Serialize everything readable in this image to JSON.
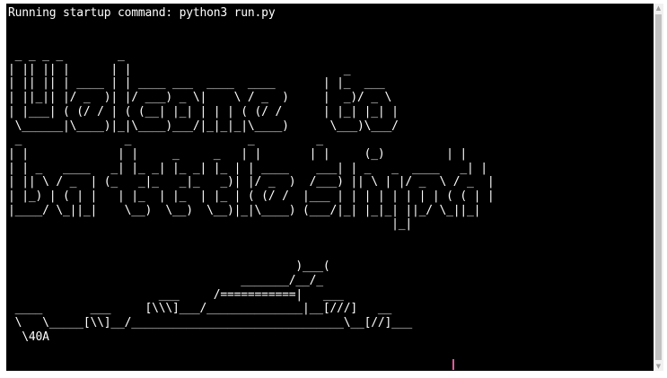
{
  "colors": {
    "background": "#000000",
    "text": "#ffffff",
    "cursor": "#e05a9a",
    "scrollbar_track": "#f1f1f1",
    "scrollbar_thumb": "#c1c1c1"
  },
  "terminal": {
    "lines": [
      "Running startup command: python3 run.py",
      "",
      "",
      " _ _ _ _        _",
      "| || || |      | |                               _",
      "| || || | ____ | | ____ ___  ____  ____       | |_  ___",
      "| ||_|| |/ _  )| |/ ___) _ \\|    \\ / _  )     |  _)/ _ \\",
      "| |___| ( (/ / | ( (__| |_| | | | ( (/ /      | |_| |_| |",
      " \\______|\\____)|_|\\____)___/|_|_|_|\\____)      \\___)\\___/",
      " _               _                 _         _",
      "| |             | |     _     _   | |       | |     (_)         | |",
      "| | _   ____   _| |_ _| |_ _| |_ | | ____    ___| | _   _  ____   _| |",
      "| || \\ / _  | (_   _|_   _|_   _)| |/ _  )  /___) || \\ | |/ _  \\ / _  |",
      "| |_) | ( | |   | |_  | |_  | |_ | ( (/ /  |___ | | | | | | | | ( ( | |",
      "|____/ \\_||_|    \\__)  \\__)  \\__)|_|\\____) (___/|_| |_|_| ||_/ \\_||_|",
      "                                                        |_|",
      "",
      "",
      "                                          )___(",
      "                                  _______/__/_",
      "                      ___     /===========|   ___",
      " ____       ___     [\\\\\\]___/______________|__[///]   __",
      " \\   \\_____[\\\\]__/_______________________________\\__[//]___",
      "  \\40A"
    ]
  },
  "scrollbar": {
    "up_arrow": "▲",
    "down_arrow": "▼",
    "position_fraction": 1.0
  }
}
